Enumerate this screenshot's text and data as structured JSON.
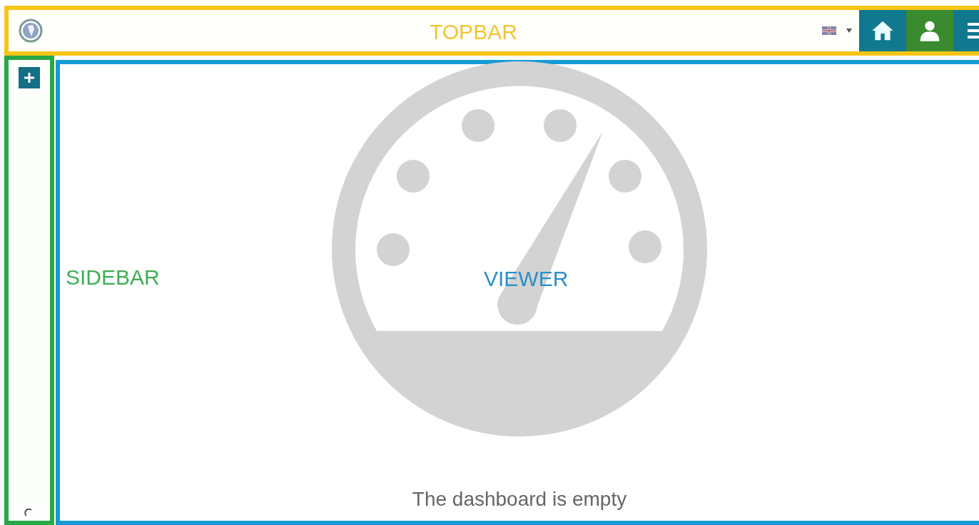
{
  "topbar": {
    "label": "TOPBAR"
  },
  "sidebar": {
    "label": "SIDEBAR"
  },
  "viewer": {
    "label": "VIEWER",
    "empty_message": "The dashboard is empty"
  }
}
